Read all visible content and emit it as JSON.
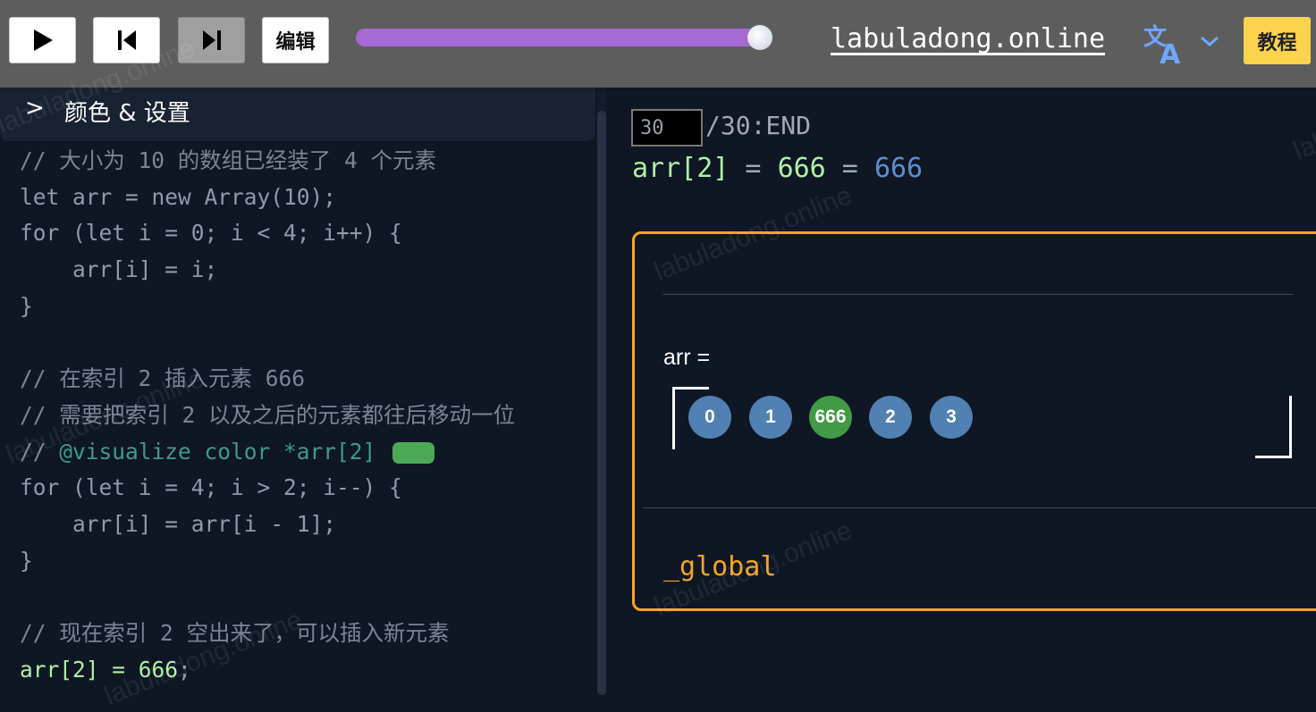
{
  "toolbar": {
    "buttons": {
      "play": "play-icon",
      "step_back": "skip-back-icon",
      "step_forward": "skip-forward-icon"
    },
    "edit_label": "编辑",
    "progress_fraction": 1.0,
    "site_link": "labuladong.online",
    "translate_icon": "translate-icon",
    "tutorial_label": "教程",
    "colors": {
      "bar": "#5d5d5d",
      "slider": "#a56ad6",
      "tutorial": "#fcd34d"
    }
  },
  "settings": {
    "chevron": ">",
    "label": "颜色 & 设置"
  },
  "code": {
    "lines": [
      "// 大小为 10 的数组已经装了 4 个元素",
      "let arr = new Array(10);",
      "for (let i = 0; i < 4; i++) {",
      "    arr[i] = i;",
      "}",
      "",
      "// 在索引 2 插入元素 666",
      "// 需要把索引 2 以及之后的元素都往后移动一位",
      "// ",
      "@visualize color *arr[2]",
      "for (let i = 4; i > 2; i--) {",
      "    arr[i] = arr[i - 1];",
      "}",
      "",
      "// 现在索引 2 空出来了，可以插入新元素",
      "arr[2] = 666",
      ";"
    ],
    "chip_color": "#4caa56"
  },
  "step": {
    "current": "30",
    "total_label": "/30:END"
  },
  "expression": {
    "code": "arr[2]",
    "eq1": " = ",
    "value": "666",
    "eq2": " = ",
    "result": "666"
  },
  "viz": {
    "array_label": "arr =",
    "elements": [
      "0",
      "1",
      "666",
      "2",
      "3"
    ],
    "highlighted_index": 2,
    "scope_label": "_global",
    "colors": {
      "border": "#f5a524",
      "node": "#5180b2",
      "node_active": "#429946"
    }
  },
  "watermark_text": "labuladong.online"
}
